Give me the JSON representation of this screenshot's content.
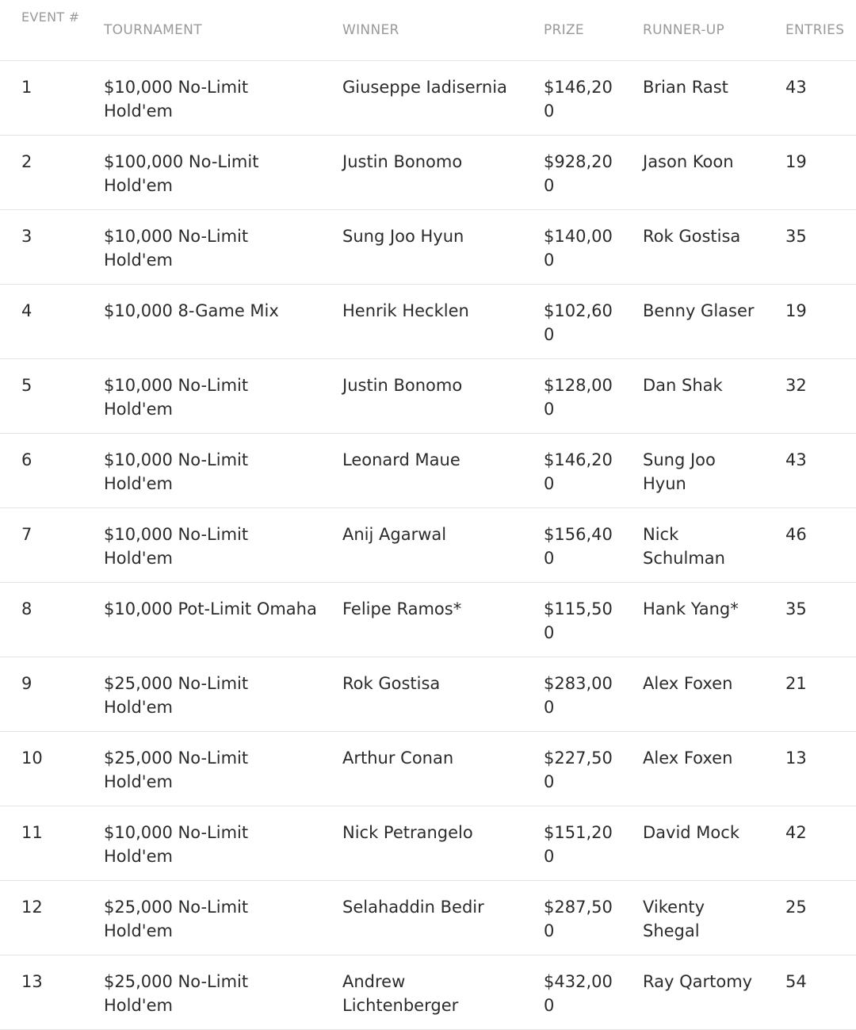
{
  "headers": {
    "event": "EVENT #",
    "tournament": "TOURNAMENT",
    "winner": "WINNER",
    "prize": "PRIZE",
    "runner_up": "RUNNER-UP",
    "entries": "ENTRIES"
  },
  "rows": [
    {
      "event": "1",
      "tournament": "$10,000 No-Limit Hold'em",
      "winner": "Giuseppe Iadisernia",
      "prize": "$146,200",
      "runner_up": "Brian Rast",
      "entries": "43"
    },
    {
      "event": "2",
      "tournament": "$100,000 No-Limit Hold'em",
      "winner": "Justin Bonomo",
      "prize": "$928,200",
      "runner_up": "Jason Koon",
      "entries": "19"
    },
    {
      "event": "3",
      "tournament": "$10,000 No-Limit Hold'em",
      "winner": "Sung Joo Hyun",
      "prize": "$140,000",
      "runner_up": "Rok Gostisa",
      "entries": "35"
    },
    {
      "event": "4",
      "tournament": "$10,000 8-Game Mix",
      "winner": "Henrik Hecklen",
      "prize": "$102,600",
      "runner_up": "Benny Glaser",
      "entries": "19"
    },
    {
      "event": "5",
      "tournament": "$10,000 No-Limit Hold'em",
      "winner": "Justin Bonomo",
      "prize": "$128,000",
      "runner_up": "Dan Shak",
      "entries": "32"
    },
    {
      "event": "6",
      "tournament": "$10,000 No-Limit Hold'em",
      "winner": "Leonard Maue",
      "prize": "$146,200",
      "runner_up": "Sung Joo Hyun",
      "entries": "43"
    },
    {
      "event": "7",
      "tournament": "$10,000 No-Limit Hold'em",
      "winner": "Anij Agarwal",
      "prize": "$156,400",
      "runner_up": "Nick Schulman",
      "entries": "46"
    },
    {
      "event": "8",
      "tournament": "$10,000 Pot-Limit Omaha",
      "winner": "Felipe Ramos*",
      "prize": "$115,500",
      "runner_up": "Hank Yang*",
      "entries": "35"
    },
    {
      "event": "9",
      "tournament": "$25,000 No-Limit Hold'em",
      "winner": "Rok Gostisa",
      "prize": "$283,000",
      "runner_up": "Alex Foxen",
      "entries": "21"
    },
    {
      "event": "10",
      "tournament": "$25,000 No-Limit Hold'em",
      "winner": "Arthur Conan",
      "prize": "$227,500",
      "runner_up": "Alex Foxen",
      "entries": "13"
    },
    {
      "event": "11",
      "tournament": "$10,000 No-Limit Hold'em",
      "winner": "Nick Petrangelo",
      "prize": "$151,200",
      "runner_up": "David Mock",
      "entries": "42"
    },
    {
      "event": "12",
      "tournament": "$25,000 No-Limit Hold'em",
      "winner": "Selahaddin Bedir",
      "prize": "$287,500",
      "runner_up": "Vikenty Shegal",
      "entries": "25"
    },
    {
      "event": "13",
      "tournament": "$25,000 No-Limit Hold'em",
      "winner": "Andrew Lichtenberger",
      "prize": "$432,000",
      "runner_up": "Ray Qartomy",
      "entries": "54"
    }
  ]
}
